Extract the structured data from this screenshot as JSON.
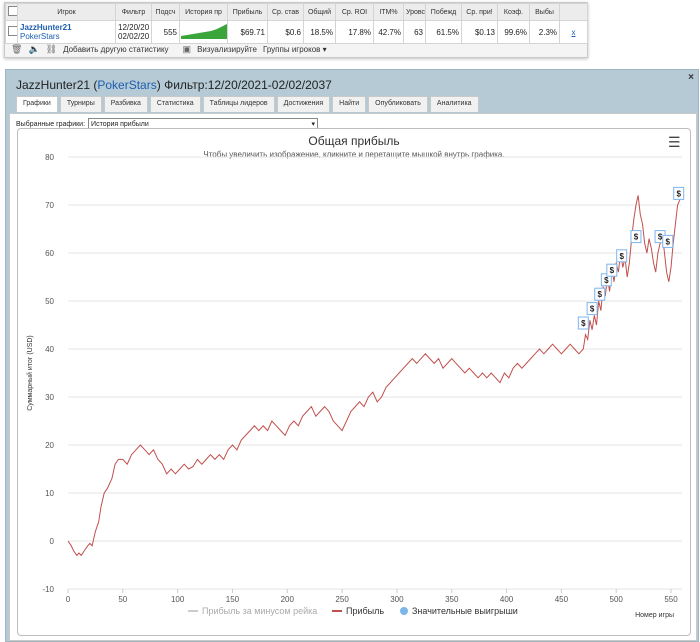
{
  "table": {
    "headers": [
      "Игрок",
      "Фильтр",
      "Подсч",
      "История пр",
      "Прибыль",
      "Ср. став",
      "Общий",
      "Ср. ROI",
      "ITM%",
      "Уровс",
      "Побежд",
      "Ср. при!",
      "Коэф.",
      "Выбы"
    ],
    "row": {
      "player": "JazzHunter21",
      "site": "PokerStars",
      "filter_line1": "12/20/20",
      "filter_line2": "02/02/20",
      "count": "555",
      "profit": "$69.71",
      "avg_stake": "$0.6",
      "total": "18.5%",
      "avg_roi": "17.8%",
      "itm": "42.7%",
      "level": "63",
      "won": "61.5%",
      "avg_prize": "$0.13",
      "coef": "99.6%",
      "out": "2.3%",
      "remove": "x"
    }
  },
  "toolbar": {
    "add_stats": "Добавить другую статистику",
    "visualize": "Визуализируйте",
    "groups": "Группы игроков"
  },
  "window": {
    "title_prefix": "JazzHunter21 (",
    "title_site": "PokerStars",
    "title_suffix": ") Фильтр:12/20/2021-02/02/2037",
    "close": "×"
  },
  "tabs": [
    "Графики",
    "Турниры",
    "Разбивка",
    "Статистика",
    "Таблицы лидеров",
    "Достижения",
    "Найти",
    "Опубликовать",
    "Аналитика"
  ],
  "selector": {
    "label": "Выбранные графики:",
    "value": "История прибыли"
  },
  "chart_data": {
    "type": "line",
    "title": "Общая прибыль",
    "subtitle": "Чтобы увеличить изображение, кликните и перетащите мышкой внутрь графика.",
    "xlabel": "Номер игры",
    "ylabel": "Суммарный итог (USD)",
    "xlim": [
      0,
      560
    ],
    "ylim": [
      -10,
      80
    ],
    "x_ticks": [
      0,
      50,
      100,
      150,
      200,
      250,
      300,
      350,
      400,
      450,
      500,
      550
    ],
    "y_ticks": [
      -10,
      0,
      10,
      20,
      30,
      40,
      50,
      60,
      70,
      80
    ],
    "series": [
      {
        "name": "Прибыль",
        "color": "#c0504d",
        "points": [
          [
            0,
            0
          ],
          [
            3,
            -1
          ],
          [
            5,
            -2
          ],
          [
            8,
            -3
          ],
          [
            10,
            -2.5
          ],
          [
            12,
            -3
          ],
          [
            15,
            -2
          ],
          [
            18,
            -1
          ],
          [
            20,
            -0.5
          ],
          [
            22,
            -1
          ],
          [
            25,
            2
          ],
          [
            28,
            4
          ],
          [
            30,
            7
          ],
          [
            33,
            10
          ],
          [
            36,
            11
          ],
          [
            40,
            13
          ],
          [
            43,
            16
          ],
          [
            46,
            17
          ],
          [
            50,
            17
          ],
          [
            54,
            16
          ],
          [
            58,
            18
          ],
          [
            62,
            19
          ],
          [
            66,
            20
          ],
          [
            70,
            19
          ],
          [
            74,
            18
          ],
          [
            78,
            19
          ],
          [
            82,
            17
          ],
          [
            86,
            16
          ],
          [
            90,
            14
          ],
          [
            94,
            15
          ],
          [
            98,
            14
          ],
          [
            102,
            15
          ],
          [
            106,
            16
          ],
          [
            110,
            15
          ],
          [
            114,
            15.5
          ],
          [
            118,
            17
          ],
          [
            122,
            16
          ],
          [
            126,
            17
          ],
          [
            130,
            18
          ],
          [
            134,
            17
          ],
          [
            138,
            18
          ],
          [
            142,
            17
          ],
          [
            146,
            19
          ],
          [
            150,
            20
          ],
          [
            154,
            19
          ],
          [
            158,
            21
          ],
          [
            162,
            22
          ],
          [
            166,
            23
          ],
          [
            170,
            24
          ],
          [
            174,
            23
          ],
          [
            178,
            24
          ],
          [
            182,
            23
          ],
          [
            186,
            25
          ],
          [
            190,
            24
          ],
          [
            194,
            23
          ],
          [
            198,
            22
          ],
          [
            202,
            24
          ],
          [
            206,
            25
          ],
          [
            210,
            24
          ],
          [
            214,
            26
          ],
          [
            218,
            27
          ],
          [
            222,
            28
          ],
          [
            226,
            26
          ],
          [
            230,
            27
          ],
          [
            234,
            28
          ],
          [
            238,
            27
          ],
          [
            242,
            25
          ],
          [
            246,
            24
          ],
          [
            250,
            23
          ],
          [
            254,
            25
          ],
          [
            258,
            27
          ],
          [
            262,
            28
          ],
          [
            266,
            29
          ],
          [
            270,
            28
          ],
          [
            274,
            30
          ],
          [
            278,
            31
          ],
          [
            282,
            29
          ],
          [
            286,
            30
          ],
          [
            290,
            32
          ],
          [
            294,
            33
          ],
          [
            298,
            34
          ],
          [
            302,
            35
          ],
          [
            306,
            36
          ],
          [
            310,
            37
          ],
          [
            314,
            38
          ],
          [
            318,
            37
          ],
          [
            322,
            38
          ],
          [
            326,
            39
          ],
          [
            330,
            38
          ],
          [
            334,
            37
          ],
          [
            338,
            38
          ],
          [
            342,
            36
          ],
          [
            346,
            37
          ],
          [
            350,
            38
          ],
          [
            354,
            37
          ],
          [
            358,
            36
          ],
          [
            362,
            35
          ],
          [
            366,
            36
          ],
          [
            370,
            35
          ],
          [
            374,
            34
          ],
          [
            378,
            35
          ],
          [
            382,
            34
          ],
          [
            386,
            35
          ],
          [
            390,
            34
          ],
          [
            394,
            33
          ],
          [
            398,
            35
          ],
          [
            402,
            34
          ],
          [
            406,
            36
          ],
          [
            410,
            37
          ],
          [
            414,
            36
          ],
          [
            418,
            37
          ],
          [
            422,
            38
          ],
          [
            426,
            39
          ],
          [
            430,
            40
          ],
          [
            434,
            39
          ],
          [
            438,
            40
          ],
          [
            442,
            41
          ],
          [
            446,
            40
          ],
          [
            450,
            39
          ],
          [
            454,
            40
          ],
          [
            458,
            41
          ],
          [
            462,
            40
          ],
          [
            466,
            39
          ],
          [
            470,
            40
          ],
          [
            472,
            43
          ],
          [
            474,
            42
          ],
          [
            476,
            46
          ],
          [
            478,
            44
          ],
          [
            480,
            47
          ],
          [
            482,
            45
          ],
          [
            484,
            50
          ],
          [
            486,
            48
          ],
          [
            488,
            53
          ],
          [
            490,
            51
          ],
          [
            492,
            55
          ],
          [
            494,
            52
          ],
          [
            496,
            57
          ],
          [
            498,
            54
          ],
          [
            500,
            58
          ],
          [
            502,
            56
          ],
          [
            504,
            60
          ],
          [
            506,
            57
          ],
          [
            508,
            59
          ],
          [
            510,
            55
          ],
          [
            512,
            58
          ],
          [
            514,
            63
          ],
          [
            516,
            67
          ],
          [
            518,
            70
          ],
          [
            520,
            72
          ],
          [
            522,
            68
          ],
          [
            524,
            66
          ],
          [
            526,
            62
          ],
          [
            528,
            60
          ],
          [
            530,
            63
          ],
          [
            532,
            61
          ],
          [
            534,
            58
          ],
          [
            536,
            56
          ],
          [
            538,
            60
          ],
          [
            540,
            62
          ],
          [
            542,
            64
          ],
          [
            544,
            60
          ],
          [
            546,
            56
          ],
          [
            548,
            54
          ],
          [
            550,
            57
          ],
          [
            552,
            62
          ],
          [
            554,
            66
          ],
          [
            556,
            70
          ],
          [
            558,
            71
          ]
        ]
      }
    ],
    "big_wins": [
      [
        470,
        45
      ],
      [
        478,
        48
      ],
      [
        485,
        51
      ],
      [
        491,
        54
      ],
      [
        496,
        56
      ],
      [
        505,
        59
      ],
      [
        518,
        63
      ],
      [
        540,
        63
      ],
      [
        547,
        62
      ],
      [
        557,
        72
      ]
    ],
    "legend": [
      "Прибыль за минусом рейка",
      "Прибыль",
      "Значительные выигрыши"
    ],
    "legend_colors": [
      "#cccccc",
      "#c0504d",
      "#7cb5ec"
    ],
    "big_win_symbol": "$"
  }
}
